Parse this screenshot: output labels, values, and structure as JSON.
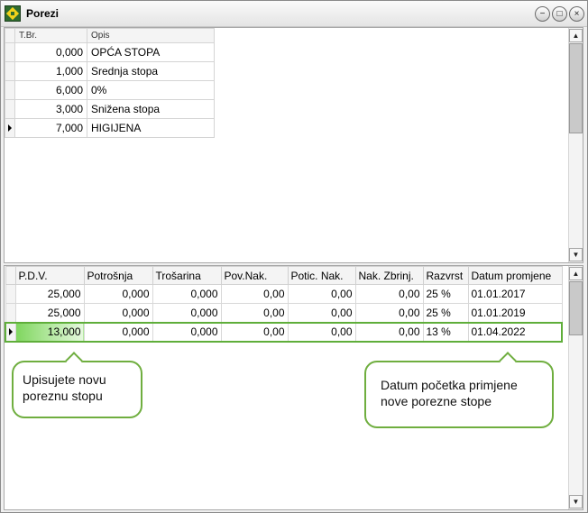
{
  "window": {
    "title": "Porezi",
    "controls": [
      "−",
      "□",
      "×"
    ]
  },
  "top_grid": {
    "headers": [
      "T.Br.",
      "Opis"
    ],
    "rows": [
      {
        "tbr": "0,000",
        "opis": "OPĆA STOPA"
      },
      {
        "tbr": "1,000",
        "opis": "Srednja stopa"
      },
      {
        "tbr": "6,000",
        "opis": "0%"
      },
      {
        "tbr": "3,000",
        "opis": "Snižena stopa"
      },
      {
        "tbr": "7,000",
        "opis": "HIGIJENA"
      }
    ],
    "current_row": 4
  },
  "bottom_grid": {
    "headers": [
      "P.D.V.",
      "Potrošnja",
      "Trošarina",
      "Pov.Nak.",
      "Potic. Nak.",
      "Nak. Zbrinj.",
      "Razvrst",
      "Datum promjene"
    ],
    "rows": [
      [
        "25,000",
        "0,000",
        "0,000",
        "0,00",
        "0,00",
        "0,00",
        "25 %",
        "01.01.2017"
      ],
      [
        "25,000",
        "0,000",
        "0,000",
        "0,00",
        "0,00",
        "0,00",
        "25 %",
        "01.01.2019"
      ],
      [
        "13,000",
        "0,000",
        "0,000",
        "0,00",
        "0,00",
        "0,00",
        "13 %",
        "01.04.2022"
      ]
    ],
    "current_row": 2
  },
  "callouts": {
    "left": "Upisujete novu poreznu stopu",
    "right": "Datum početka primjene nove porezne stope"
  },
  "colors": {
    "highlight_green": "#7fd65e",
    "callout_border": "#6fae3f"
  }
}
